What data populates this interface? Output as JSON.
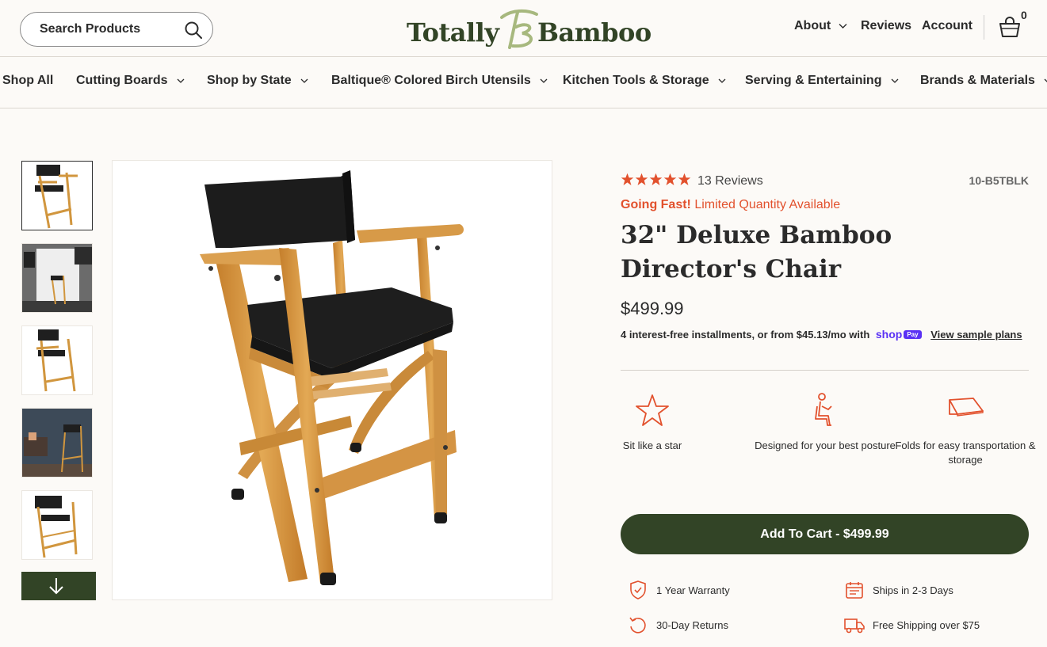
{
  "header": {
    "search_placeholder": "Search Products",
    "logo_left": "Totally",
    "logo_right": "Bamboo",
    "nav": [
      "About",
      "Reviews",
      "Account"
    ],
    "cart_count": "0"
  },
  "categories": [
    "Shop All",
    "Cutting Boards",
    "Shop by State",
    "Baltique® Colored Birch Utensils",
    "Kitchen Tools & Storage",
    "Serving & Entertaining",
    "Brands & Materials"
  ],
  "gallery": {
    "thumbnails": [
      "chair-front",
      "studio-scene",
      "chair-angle",
      "living-room-scene",
      "chair-back"
    ],
    "active_index": 0,
    "down_icon": "arrow-down-icon"
  },
  "product": {
    "rating": 5,
    "reviews_label": "13 Reviews",
    "sku": "10-B5TBLK",
    "urgency_bold": "Going Fast!",
    "urgency_rest": "Limited Quantity Available",
    "title": "32\" Deluxe Bamboo Director's Chair",
    "price": "$499.99",
    "installments_text": "4 interest-free installments, or from $45.13/mo with",
    "shop_label": "shop",
    "pay_label": "Pay",
    "sample_plans": "View sample plans",
    "features": [
      {
        "icon": "star-icon",
        "label": "Sit like a star"
      },
      {
        "icon": "posture-icon",
        "label": "Designed for your best posture"
      },
      {
        "icon": "fold-icon",
        "label": "Folds for easy transportation & storage"
      }
    ],
    "add_to_cart": "Add To Cart - $499.99",
    "perks": [
      {
        "icon": "shield-check-icon",
        "label": "1 Year Warranty"
      },
      {
        "icon": "calendar-icon",
        "label": "Ships in 2-3 Days"
      },
      {
        "icon": "return-icon",
        "label": "30-Day Returns"
      },
      {
        "icon": "truck-icon",
        "label": "Free Shipping over $75"
      }
    ]
  },
  "colors": {
    "brand_green": "#324426",
    "accent_orange": "#e2512d",
    "shop_pay": "#5a31f4",
    "background": "#fcfaf7"
  }
}
